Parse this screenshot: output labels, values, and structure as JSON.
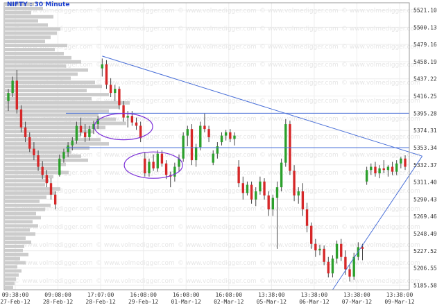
{
  "chart_data": {
    "type": "candlestick",
    "title": "NIFTY : 30 Minute",
    "watermark": "www.volmedigger.com",
    "ylim": [
      5180,
      5530
    ],
    "yticks": [
      5521.1,
      5500.13,
      5479.16,
      5458.19,
      5437.22,
      5416.25,
      5395.28,
      5374.31,
      5353.34,
      5332.37,
      5311.4,
      5290.43,
      5269.46,
      5248.49,
      5227.52,
      5206.55,
      5185.58
    ],
    "xticks": [
      {
        "time": "09:38:00",
        "date": "27-Feb-12"
      },
      {
        "time": "09:08:00",
        "date": "28-Feb-12"
      },
      {
        "time": "17:07:00",
        "date": "28-Feb-12"
      },
      {
        "time": "16:08:00",
        "date": "29-Feb-12"
      },
      {
        "time": "16:08:00",
        "date": "01-Mar-12"
      },
      {
        "time": "16:08:00",
        "date": "02-Mar-12"
      },
      {
        "time": "13:38:00",
        "date": "05-Mar-12"
      },
      {
        "time": "13:38:00",
        "date": "06-Mar-12"
      },
      {
        "time": "13:38:00",
        "date": "07-Mar-12"
      },
      {
        "time": "13:38:00",
        "date": "09-Mar-12"
      }
    ],
    "candles": [
      {
        "o": 5410,
        "h": 5425,
        "l": 5398,
        "c": 5420
      },
      {
        "o": 5420,
        "h": 5440,
        "l": 5415,
        "c": 5435
      },
      {
        "o": 5435,
        "h": 5448,
        "l": 5395,
        "c": 5400
      },
      {
        "o": 5400,
        "h": 5405,
        "l": 5372,
        "c": 5378
      },
      {
        "o": 5378,
        "h": 5385,
        "l": 5360,
        "c": 5366
      },
      {
        "o": 5366,
        "h": 5372,
        "l": 5348,
        "c": 5352
      },
      {
        "o": 5352,
        "h": 5360,
        "l": 5338,
        "c": 5344
      },
      {
        "o": 5344,
        "h": 5350,
        "l": 5325,
        "c": 5330
      },
      {
        "o": 5330,
        "h": 5337,
        "l": 5315,
        "c": 5320
      },
      {
        "o": 5320,
        "h": 5326,
        "l": 5305,
        "c": 5310
      },
      {
        "o": 5310,
        "h": 5316,
        "l": 5290,
        "c": 5296
      },
      {
        "o": 5296,
        "h": 5300,
        "l": 5278,
        "c": 5284
      },
      {
        "o": 5320,
        "h": 5345,
        "l": 5318,
        "c": 5340
      },
      {
        "o": 5340,
        "h": 5352,
        "l": 5335,
        "c": 5348
      },
      {
        "o": 5348,
        "h": 5360,
        "l": 5342,
        "c": 5356
      },
      {
        "o": 5356,
        "h": 5366,
        "l": 5350,
        "c": 5362
      },
      {
        "o": 5362,
        "h": 5385,
        "l": 5358,
        "c": 5380
      },
      {
        "o": 5380,
        "h": 5390,
        "l": 5368,
        "c": 5372
      },
      {
        "o": 5372,
        "h": 5382,
        "l": 5360,
        "c": 5366
      },
      {
        "o": 5366,
        "h": 5380,
        "l": 5362,
        "c": 5376
      },
      {
        "o": 5376,
        "h": 5386,
        "l": 5370,
        "c": 5382
      },
      {
        "o": 5382,
        "h": 5392,
        "l": 5376,
        "c": 5388
      },
      {
        "o": 5450,
        "h": 5462,
        "l": 5440,
        "c": 5455
      },
      {
        "o": 5455,
        "h": 5460,
        "l": 5425,
        "c": 5430
      },
      {
        "o": 5430,
        "h": 5438,
        "l": 5415,
        "c": 5420
      },
      {
        "o": 5420,
        "h": 5430,
        "l": 5410,
        "c": 5425
      },
      {
        "o": 5425,
        "h": 5428,
        "l": 5400,
        "c": 5405
      },
      {
        "o": 5405,
        "h": 5410,
        "l": 5385,
        "c": 5390
      },
      {
        "o": 5390,
        "h": 5398,
        "l": 5378,
        "c": 5392
      },
      {
        "o": 5392,
        "h": 5398,
        "l": 5380,
        "c": 5384
      },
      {
        "o": 5384,
        "h": 5390,
        "l": 5375,
        "c": 5380
      },
      {
        "o": 5380,
        "h": 5385,
        "l": 5360,
        "c": 5365
      },
      {
        "o": 5340,
        "h": 5348,
        "l": 5318,
        "c": 5322
      },
      {
        "o": 5322,
        "h": 5340,
        "l": 5318,
        "c": 5336
      },
      {
        "o": 5336,
        "h": 5345,
        "l": 5325,
        "c": 5328
      },
      {
        "o": 5328,
        "h": 5350,
        "l": 5324,
        "c": 5346
      },
      {
        "o": 5346,
        "h": 5350,
        "l": 5330,
        "c": 5334
      },
      {
        "o": 5334,
        "h": 5338,
        "l": 5315,
        "c": 5320
      },
      {
        "o": 5320,
        "h": 5324,
        "l": 5305,
        "c": 5318
      },
      {
        "o": 5318,
        "h": 5335,
        "l": 5312,
        "c": 5330
      },
      {
        "o": 5330,
        "h": 5345,
        "l": 5325,
        "c": 5340
      },
      {
        "o": 5340,
        "h": 5372,
        "l": 5336,
        "c": 5368
      },
      {
        "o": 5368,
        "h": 5380,
        "l": 5355,
        "c": 5376
      },
      {
        "o": 5376,
        "h": 5382,
        "l": 5332,
        "c": 5338
      },
      {
        "o": 5338,
        "h": 5358,
        "l": 5330,
        "c": 5354
      },
      {
        "o": 5354,
        "h": 5385,
        "l": 5350,
        "c": 5380
      },
      {
        "o": 5380,
        "h": 5395,
        "l": 5372,
        "c": 5376
      },
      {
        "o": 5376,
        "h": 5380,
        "l": 5360,
        "c": 5366
      },
      {
        "o": 5335,
        "h": 5350,
        "l": 5332,
        "c": 5346
      },
      {
        "o": 5346,
        "h": 5360,
        "l": 5340,
        "c": 5355
      },
      {
        "o": 5360,
        "h": 5372,
        "l": 5356,
        "c": 5368
      },
      {
        "o": 5368,
        "h": 5375,
        "l": 5362,
        "c": 5372
      },
      {
        "o": 5372,
        "h": 5376,
        "l": 5360,
        "c": 5364
      },
      {
        "o": 5364,
        "h": 5372,
        "l": 5356,
        "c": 5368
      },
      {
        "o": 5330,
        "h": 5338,
        "l": 5305,
        "c": 5310
      },
      {
        "o": 5310,
        "h": 5318,
        "l": 5290,
        "c": 5298
      },
      {
        "o": 5298,
        "h": 5312,
        "l": 5295,
        "c": 5308
      },
      {
        "o": 5308,
        "h": 5312,
        "l": 5285,
        "c": 5290
      },
      {
        "o": 5290,
        "h": 5305,
        "l": 5282,
        "c": 5300
      },
      {
        "o": 5300,
        "h": 5318,
        "l": 5296,
        "c": 5312
      },
      {
        "o": 5312,
        "h": 5316,
        "l": 5290,
        "c": 5295
      },
      {
        "o": 5295,
        "h": 5300,
        "l": 5270,
        "c": 5278
      },
      {
        "o": 5278,
        "h": 5296,
        "l": 5270,
        "c": 5292
      },
      {
        "o": 5292,
        "h": 5312,
        "l": 5230,
        "c": 5305
      },
      {
        "o": 5305,
        "h": 5340,
        "l": 5300,
        "c": 5335
      },
      {
        "o": 5335,
        "h": 5388,
        "l": 5330,
        "c": 5382
      },
      {
        "o": 5382,
        "h": 5386,
        "l": 5320,
        "c": 5325
      },
      {
        "o": 5325,
        "h": 5332,
        "l": 5288,
        "c": 5295
      },
      {
        "o": 5295,
        "h": 5305,
        "l": 5285,
        "c": 5300
      },
      {
        "o": 5300,
        "h": 5310,
        "l": 5270,
        "c": 5278
      },
      {
        "o": 5278,
        "h": 5286,
        "l": 5250,
        "c": 5258
      },
      {
        "o": 5258,
        "h": 5262,
        "l": 5230,
        "c": 5236
      },
      {
        "o": 5236,
        "h": 5242,
        "l": 5220,
        "c": 5228
      },
      {
        "o": 5228,
        "h": 5235,
        "l": 5222,
        "c": 5230
      },
      {
        "o": 5230,
        "h": 5234,
        "l": 5210,
        "c": 5214
      },
      {
        "o": 5214,
        "h": 5220,
        "l": 5195,
        "c": 5200
      },
      {
        "o": 5200,
        "h": 5222,
        "l": 5195,
        "c": 5218
      },
      {
        "o": 5218,
        "h": 5240,
        "l": 5212,
        "c": 5236
      },
      {
        "o": 5236,
        "h": 5242,
        "l": 5215,
        "c": 5220
      },
      {
        "o": 5220,
        "h": 5228,
        "l": 5198,
        "c": 5205
      },
      {
        "o": 5205,
        "h": 5210,
        "l": 5190,
        "c": 5196
      },
      {
        "o": 5196,
        "h": 5225,
        "l": 5192,
        "c": 5220
      },
      {
        "o": 5220,
        "h": 5238,
        "l": 5216,
        "c": 5232
      },
      {
        "o": 5232,
        "h": 5236,
        "l": 5216,
        "c": 5230
      },
      {
        "o": 5312,
        "h": 5330,
        "l": 5308,
        "c": 5326
      },
      {
        "o": 5326,
        "h": 5334,
        "l": 5320,
        "c": 5330
      },
      {
        "o": 5330,
        "h": 5336,
        "l": 5318,
        "c": 5322
      },
      {
        "o": 5322,
        "h": 5332,
        "l": 5316,
        "c": 5328
      },
      {
        "o": 5328,
        "h": 5338,
        "l": 5322,
        "c": 5326
      },
      {
        "o": 5326,
        "h": 5332,
        "l": 5318,
        "c": 5330
      },
      {
        "o": 5330,
        "h": 5336,
        "l": 5320,
        "c": 5324
      },
      {
        "o": 5324,
        "h": 5338,
        "l": 5320,
        "c": 5334
      },
      {
        "o": 5334,
        "h": 5342,
        "l": 5328,
        "c": 5340
      },
      {
        "o": 5340,
        "h": 5344,
        "l": 5326,
        "c": 5330
      }
    ],
    "volume_profile": [
      42,
      55,
      38,
      70,
      48,
      62,
      80,
      75,
      66,
      58,
      90,
      72,
      85,
      96,
      110,
      88,
      120,
      105,
      95,
      130,
      140,
      118,
      150,
      125,
      180,
      165,
      150,
      135,
      160,
      175,
      145,
      128,
      110,
      138,
      150,
      122,
      96,
      110,
      120,
      88,
      76,
      92,
      70,
      64,
      58,
      80,
      72,
      60,
      50,
      66,
      58,
      45,
      52,
      40,
      48,
      36,
      44,
      30,
      38,
      28,
      26,
      34,
      22,
      30,
      18,
      24,
      20,
      16,
      14,
      12
    ],
    "annotations": {
      "hlines": [
        5395.28,
        5353.34
      ],
      "trendlines": [
        {
          "from": {
            "i": 22,
            "v": 5465
          },
          "to": {
            "i": 97,
            "v": 5343
          }
        },
        {
          "from": {
            "i": 76,
            "v": 5180
          },
          "to": {
            "i": 97,
            "v": 5343
          }
        }
      ],
      "ellipses": [
        {
          "i": 27,
          "v": 5379
        },
        {
          "i": 34,
          "v": 5332
        }
      ]
    },
    "colors": {
      "up": "#2ca02c",
      "down": "#d62728",
      "volume": "#cccccc",
      "grid": "#ececec",
      "trend": "#4a70d8",
      "ellipse": "#7b2fd8"
    }
  }
}
